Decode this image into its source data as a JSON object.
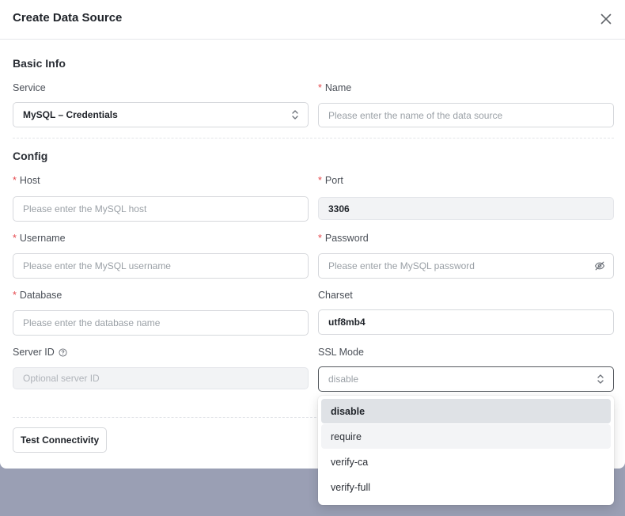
{
  "dialog": {
    "title": "Create Data Source"
  },
  "basic_info": {
    "heading": "Basic Info",
    "service_label": "Service",
    "service_value": "MySQL – Credentials",
    "name_label": "Name",
    "name_placeholder": "Please enter the name of the data source"
  },
  "config": {
    "heading": "Config",
    "host_label": "Host",
    "host_placeholder": "Please enter the MySQL host",
    "port_label": "Port",
    "port_value": "3306",
    "username_label": "Username",
    "username_placeholder": "Please enter the MySQL username",
    "password_label": "Password",
    "password_placeholder": "Please enter the MySQL password",
    "database_label": "Database",
    "database_placeholder": "Please enter the database name",
    "charset_label": "Charset",
    "charset_value": "utf8mb4",
    "server_id_label": "Server ID",
    "server_id_placeholder": "Optional server ID",
    "ssl_mode_label": "SSL Mode",
    "ssl_mode_value": "disable"
  },
  "ssl_options": [
    "disable",
    "require",
    "verify-ca",
    "verify-full"
  ],
  "ssl_selected_index": 0,
  "ssl_hover_index": 1,
  "footer": {
    "test_button": "Test Connectivity"
  },
  "required_marker": "*",
  "icons": {
    "close": "close-icon",
    "service_chevron": "chevron-up-down-icon",
    "password_toggle": "eye-off-icon",
    "server_id_help": "help-circle-icon",
    "ssl_chevron": "chevron-up-down-icon"
  },
  "colors": {
    "overlay": "#9a9fb4",
    "required": "#e5484d",
    "selected_option": "#dfe2e6"
  }
}
